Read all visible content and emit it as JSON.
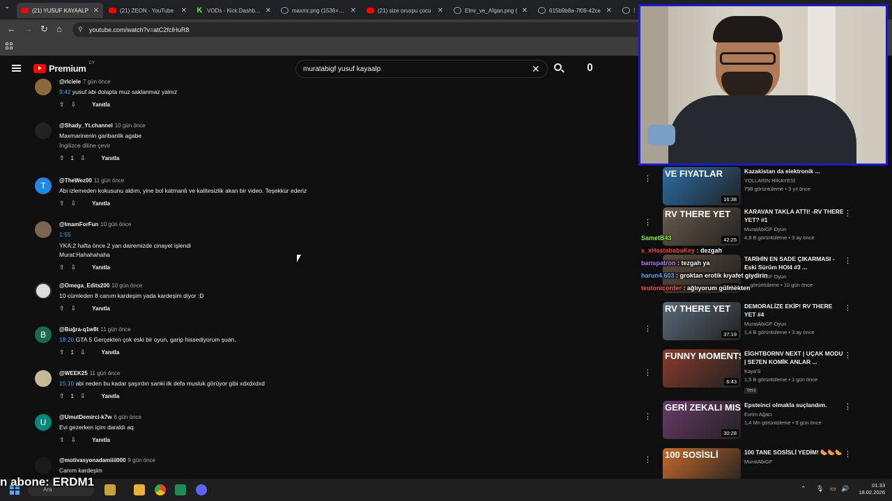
{
  "browser": {
    "tabs": [
      {
        "title": "(21) YUSUF KAYAALP",
        "icon": "youtube-icon",
        "active": true
      },
      {
        "title": "(21) ZEON - YouTube",
        "icon": "youtube-icon",
        "active": false
      },
      {
        "title": "VODs - Kick Dashboard",
        "icon": "kick-icon",
        "active": false
      },
      {
        "title": "maxmr.png (1536×1024)",
        "icon": "globe-icon",
        "active": false
      },
      {
        "title": "(21) size oruspu çocu",
        "icon": "youtube-icon",
        "active": false
      },
      {
        "title": "Elmr_ve_Afgan.png (",
        "icon": "globe-icon",
        "active": false
      },
      {
        "title": "615b9b8a-7f09-42ce",
        "icon": "globe-icon",
        "active": false
      },
      {
        "title": "S",
        "icon": "globe-icon",
        "active": false
      }
    ],
    "url": "youtube.com/watch?v=atC2fclHuR8"
  },
  "youtube": {
    "logo_text": "Premium",
    "logo_sup": "CY",
    "search_value": "muratabigf yusuf kayaalp"
  },
  "comments": [
    {
      "handle": "@rlciele",
      "date": "7 gün önce",
      "ts": "9:42",
      "text": "yusuf abi dolapta muz saklanmaz yalnız",
      "likes": "",
      "avatar_letter": "",
      "avatar_color": "#8a6a3a",
      "reply": "Yanıtla"
    },
    {
      "handle": "@Shady_Yt.channel",
      "date": "10 gün önce",
      "ts": "",
      "text": "Maxmarinenin garibanlik agabe",
      "translate": "İngilizce diline çevir",
      "likes": "1",
      "avatar_letter": "",
      "avatar_color": "#222222",
      "reply": "Yanıtla"
    },
    {
      "handle": "@TheWez00",
      "date": "11 gün önce",
      "ts": "",
      "text": "Abi izlemeden kokusunu aldım, yine bol katmanlı ve kalitesizlik akan bir video. Teşekkür ederiz",
      "likes": "",
      "avatar_letter": "T",
      "avatar_color": "#1e88e5",
      "reply": "Yanıtla"
    },
    {
      "handle": "@ImamForFun",
      "date": "10 gün önce",
      "ts": "1:55",
      "text": "YKA:2 hafta önce 2 yan dairemizde cinayet işlendi",
      "text2": "Murat:Hahahahaha",
      "likes": "",
      "avatar_letter": "",
      "avatar_color": "#7a6552",
      "reply": "Yanıtla"
    },
    {
      "handle": "@Omega_Edits200",
      "date": "10 gün önce",
      "ts": "",
      "text": "10 cümleden 8 canım kardeşim yada kardeşim diyor :D",
      "likes": "",
      "avatar_letter": "",
      "avatar_color": "#dddddd",
      "reply": "Yanıtla"
    },
    {
      "handle": "@Buğra-q1w8t",
      "date": "11 gün önce",
      "ts": "18:20",
      "text": "GTA 5 Gerçekten çok eski bir oyun, garip hissediyorum şuan.",
      "likes": "1",
      "avatar_letter": "B",
      "avatar_color": "#1b6b4a",
      "reply": "Yanıtla"
    },
    {
      "handle": "@WEEK25",
      "date": "11 gün önce",
      "ts": "15:10",
      "text": "abi neden bu kadar şaşırdın sanki ilk defa musluk görüyor gibi xdxdxdxd",
      "likes": "1",
      "avatar_letter": "",
      "avatar_color": "#c8b89a",
      "reply": "Yanıtla"
    },
    {
      "handle": "@UmutDemirci-k7w",
      "date": "6 gün önce",
      "ts": "",
      "text": "Evi gezerken içim daraldı aq",
      "likes": "",
      "avatar_letter": "U",
      "avatar_color": "#00897b",
      "reply": "Yanıtla"
    },
    {
      "handle": "@motivasyonadamiiii000",
      "date": "9 gün önce",
      "ts": "",
      "text": "Canım kardeşim",
      "likes": "",
      "avatar_letter": "",
      "avatar_color": "#1a1a1a",
      "reply": ""
    }
  ],
  "videos": [
    {
      "title": "Kazakistan da elektronik ...",
      "channel": "YOLLARIN HİKAYESİ",
      "stats": "798 görüntüleme • 3 yıl önce",
      "duration": "16:38",
      "thumb": "#2b6ea8",
      "thumb_text": "VE FIYATLAR",
      "badge": ""
    },
    {
      "title": "KARAVAN TAKLA ATTI! -RV THERE YET? #1",
      "channel": "MuratAbiGF Oyun",
      "stats": "4,8 B görüntüleme • 3 ay önce",
      "duration": "42:25",
      "thumb": "#6a5a4a",
      "thumb_text": "RV THERE YET",
      "badge": ""
    },
    {
      "title": "TARİHİN EN SADE ÇIKARMASI - Eski Sürüm HOI4 #3 ...",
      "channel": "MuratAbiGF Oyun",
      "stats": "... görüntüleme • 10 gün önce",
      "duration": "40:57",
      "thumb": "#5a4a3a",
      "thumb_text": "",
      "badge": ""
    },
    {
      "title": "DEMORALİZE EKİP! RV THERE YET #4",
      "channel": "MuratAbiGF Oyun",
      "stats": "1,4 B görüntüleme • 3 ay önce",
      "duration": "37:19",
      "thumb": "#5a6a7a",
      "thumb_text": "RV THERE YET",
      "badge": ""
    },
    {
      "title": "EİGHTBORNV NEXT | UÇAK MODU | SE7EN KOMİK ANLAR ...",
      "channel": "Kaya'S",
      "stats": "1,5 B görüntüleme • 1 gün önce",
      "duration": "6:43",
      "thumb": "#8a3a2a",
      "thumb_text": "FUNNY MOMENTS",
      "badge": "Yeni"
    },
    {
      "title": "Epsteinci olmakla suçlandım.",
      "channel": "Evrim Ağacı",
      "stats": "1,4 Mn görüntüleme • 9 gün önce",
      "duration": "30:28",
      "thumb": "#6a3a6a",
      "thumb_text": "GERİ ZEKALI MISINIZ?",
      "badge": ""
    },
    {
      "title": "100 TANE SOSİSLİ YEDİM! 🌭🌭🌭",
      "channel": "MuratAbiGF",
      "stats": "",
      "duration": "",
      "thumb": "#c86a2a",
      "thumb_text": "100 SOSİSLİ",
      "badge": ""
    }
  ],
  "chat": [
    {
      "user": "SametB43",
      "msg": "",
      "color": "#7cfc00"
    },
    {
      "user": "x_xHastababaKey",
      "msg": "dezgah",
      "color": "#ff3b3b"
    },
    {
      "user": "barispatron",
      "msg": "tezgah ya",
      "color": "#b07cff"
    },
    {
      "user": "harun4.603",
      "msg": "groktan erotik kıyafet giydirin",
      "color": "#5fa8ff"
    },
    {
      "user": "teutonicorder",
      "msg": "ağlıyorum gülmekten",
      "color": "#ff4d4d"
    }
  ],
  "overlay_text": "n abone: ERDM1",
  "taskbar": {
    "search_label": "Ara",
    "time": "01:33",
    "date": "18.02.2026"
  }
}
